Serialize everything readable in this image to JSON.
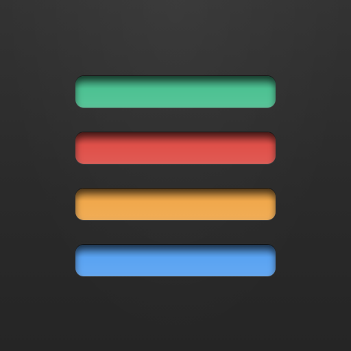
{
  "icon": {
    "background_color": "#2b2b2b",
    "bars": [
      {
        "name": "green-bar",
        "color": "#4dc192"
      },
      {
        "name": "red-bar",
        "color": "#df5049"
      },
      {
        "name": "orange-bar",
        "color": "#f0a84c"
      },
      {
        "name": "blue-bar",
        "color": "#5aa3f2"
      }
    ]
  }
}
